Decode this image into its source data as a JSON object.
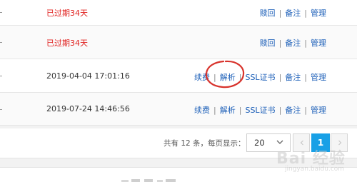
{
  "rows": [
    {
      "date": "已过期34天",
      "expired": true,
      "actions": [
        "赎回",
        "备注",
        "管理"
      ]
    },
    {
      "date": "已过期34天",
      "expired": true,
      "actions": [
        "赎回",
        "备注",
        "管理"
      ]
    },
    {
      "date": "2019-04-04 17:01:16",
      "expired": false,
      "actions": [
        "续费",
        "解析",
        "SSL证书",
        "备注",
        "管理"
      ]
    },
    {
      "date": "2019-07-24 14:46:56",
      "expired": false,
      "actions": [
        "续费",
        "解析",
        "SSL证书",
        "备注",
        "管理"
      ]
    }
  ],
  "pagination": {
    "summary": "共有 12 条，每页显示：",
    "page_size": "20",
    "current_page": "1"
  },
  "watermark": {
    "text": "Bai 经验",
    "sub": "jingyan.baidu.com"
  },
  "colors": {
    "link": "#1f61b9",
    "expired": "#e0201e",
    "active_page": "#18a0e6",
    "annotation": "#d8332c"
  }
}
